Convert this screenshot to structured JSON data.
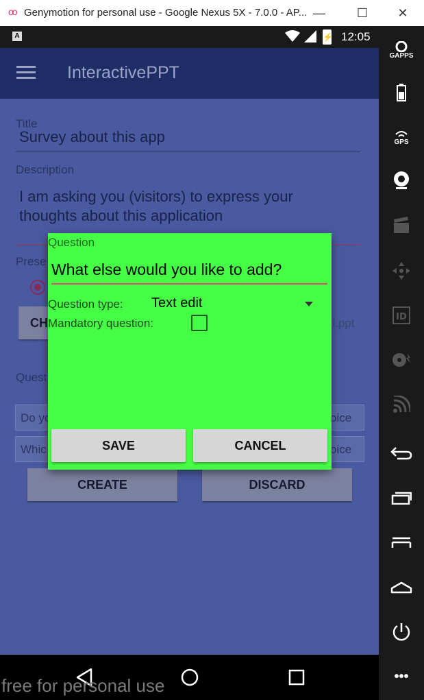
{
  "window": {
    "title": "Genymotion for personal use - Google Nexus 5X - 7.0.0 - AP...",
    "logo": "oo",
    "minimize": "—",
    "maximize": "☐",
    "close": "✕"
  },
  "statusbar": {
    "notification": "A",
    "time": "12:05",
    "battery": "⚡"
  },
  "appbar": {
    "title": "InteractivePPT"
  },
  "form": {
    "title_label": "Title",
    "title_value": "Survey about this app",
    "description_label": "Description",
    "description_line1": "I am asking you (visitors) to express your",
    "description_line2": "thoughts about this application",
    "presentation_label": "Prese",
    "choose_button": "CH",
    "file_name": "t l.ppt",
    "questions_label": "Quest",
    "question_rows": [
      {
        "left": "Do yo",
        "right": "oice"
      },
      {
        "left": "Whic",
        "right": "oice"
      }
    ],
    "create_button": "CREATE",
    "discard_button": "DISCARD"
  },
  "dialog": {
    "question_label": "Question",
    "question_value": "What else would you like to add?",
    "question_type_label": "Question type:",
    "question_type_value": "Text edit",
    "mandatory_label": "Mandatory question:",
    "mandatory_checked": false,
    "save_button": "SAVE",
    "cancel_button": "CANCEL",
    "background_color": "#45ff45"
  },
  "rail": {
    "gapps_label": "GAPPS",
    "gps_label": "GPS",
    "id_label": "ID",
    "more_label": "•••"
  },
  "watermark": "free for personal use",
  "colors": {
    "appbar": "#1f2d66",
    "accent": "#e8437a",
    "dialog_bg": "#45ff45"
  }
}
